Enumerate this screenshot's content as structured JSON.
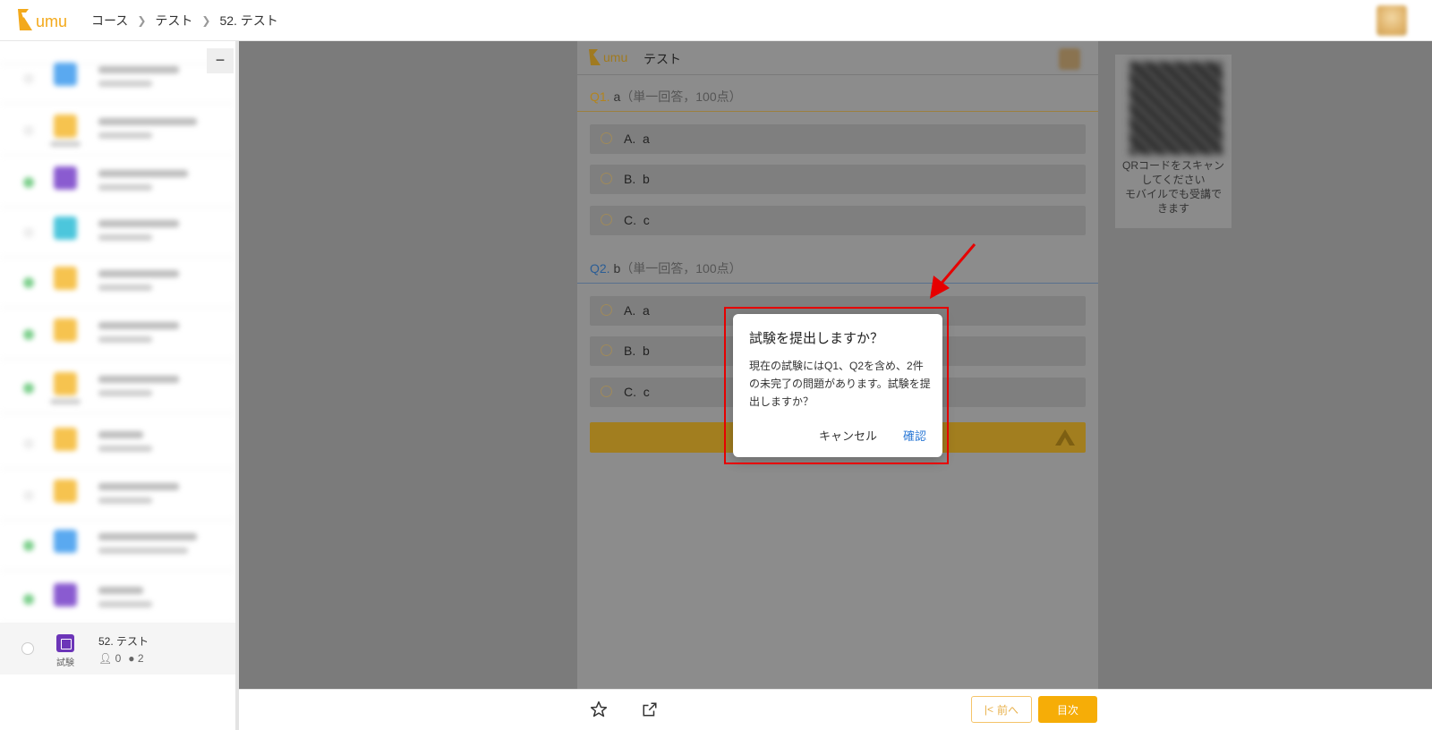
{
  "app": {
    "logo_text": "umu"
  },
  "breadcrumb": {
    "items": [
      "コース",
      "テスト",
      "52. テスト"
    ],
    "separator": ">"
  },
  "sidebar": {
    "collapse_label": "−",
    "active_item": {
      "title": "52. テスト",
      "type_label": "試験",
      "learners": "0",
      "comments": "2"
    }
  },
  "panel": {
    "title": "テスト",
    "questions": [
      {
        "number": "Q1.",
        "text": "a",
        "meta": "（単一回答，100点）",
        "color": "orange",
        "options": [
          {
            "label": "A.",
            "text": "a"
          },
          {
            "label": "B.",
            "text": "b"
          },
          {
            "label": "C.",
            "text": "c"
          }
        ]
      },
      {
        "number": "Q2.",
        "text": "b",
        "meta": "（単一回答，100点）",
        "color": "blue",
        "options": [
          {
            "label": "A.",
            "text": "a"
          },
          {
            "label": "B.",
            "text": "b"
          },
          {
            "label": "C.",
            "text": "c"
          }
        ]
      }
    ]
  },
  "qr": {
    "text_line1": "QRコードをスキャンしてください",
    "text_line2": "モバイルでも受講できます"
  },
  "dialog": {
    "title": "試験を提出しますか？",
    "body": "現在の試験にはQ1、Q2を含め、2件の未完了の問題があります。試験を提出しますか？",
    "cancel": "キャンセル",
    "confirm": "確認"
  },
  "bottom": {
    "prev_label": "前へ",
    "next_label": "目次"
  },
  "colors": {
    "accent": "#f6ad07",
    "link_blue": "#2d7ad6",
    "annotation_red": "#e60000",
    "exam_purple": "#6c35b8"
  }
}
